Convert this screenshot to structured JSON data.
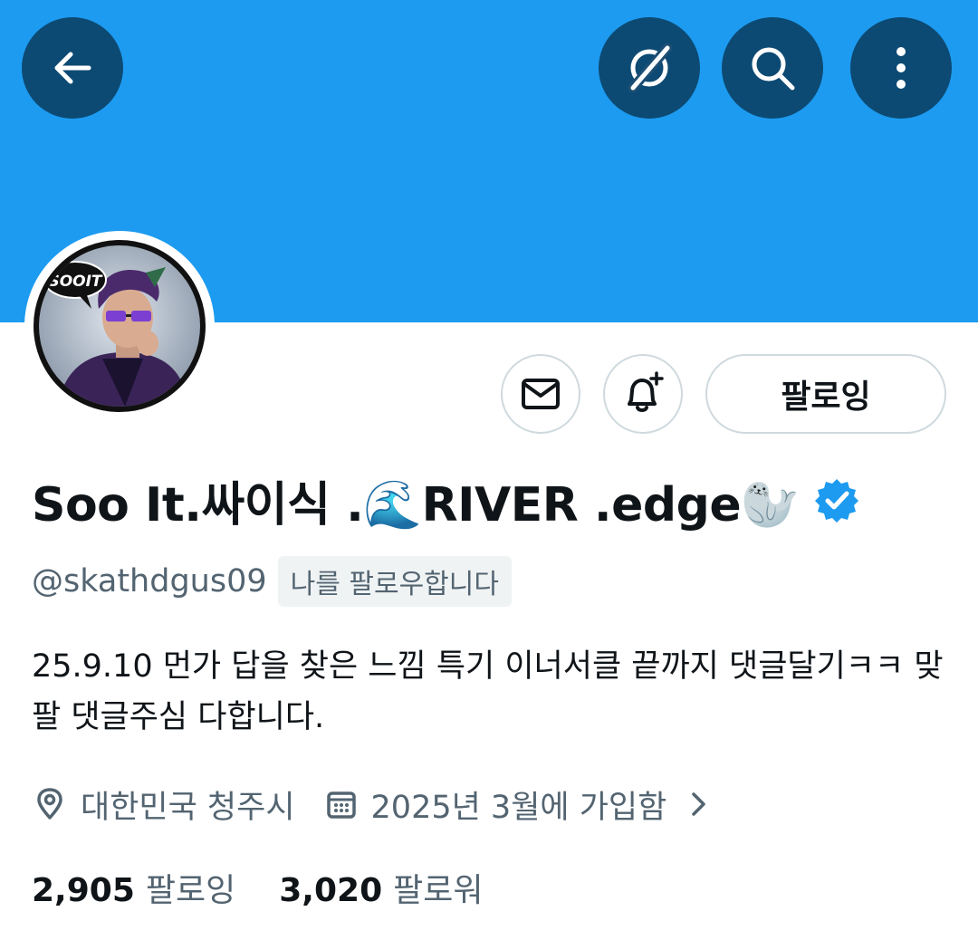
{
  "colors": {
    "banner": "#1d9bf0",
    "header_button": "#0c4a73",
    "verified": "#1d9bf0",
    "secondary_text": "#536471"
  },
  "header": {
    "icons": [
      "back-arrow-icon",
      "grok-icon",
      "search-icon",
      "more-vertical-icon"
    ]
  },
  "profile": {
    "avatar_text": "SOOIT",
    "actions": {
      "follow_label": "팔로잉"
    },
    "display_name": "Soo It.싸이식 .🌊RIVER .edge🦭",
    "verified": true,
    "handle": "@skathdgus09",
    "follows_you": "나를 팔로우합니다",
    "bio": "25.9.10 먼가 답을 찾은 느낌 특기 이너서클 끝까지 댓글달기ㅋㅋ 맞팔 댓글주심 다합니다.",
    "location": "대한민국 청주시",
    "joined": "2025년 3월에 가입함",
    "following_count": "2,905",
    "following_label": "팔로잉",
    "followers_count": "3,020",
    "followers_label": "팔로워"
  }
}
